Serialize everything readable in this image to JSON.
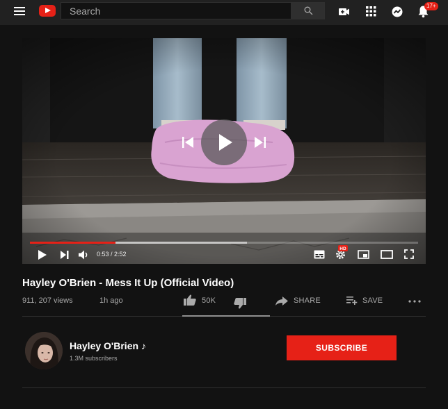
{
  "header": {
    "search_placeholder": "Search",
    "notification_count": "17+"
  },
  "player": {
    "current_time": "0:53",
    "duration": "2:52",
    "time_display": "0:53 / 2:52",
    "played_fraction": 0.22,
    "buffered_fraction": 0.56,
    "hd_badge": "HD"
  },
  "video": {
    "title": "Hayley O'Brien - Mess It Up (Official Video)",
    "views": "911, 207 views",
    "age": "1h ago",
    "likes": "50K",
    "share_label": "SHARE",
    "save_label": "SAVE",
    "like_fraction": 1.0
  },
  "channel": {
    "name": "Hayley O'Brien ♪",
    "subscribers": "1.3M subscribers",
    "subscribe_label": "SUBSCRIBE"
  },
  "colors": {
    "accent": "#e62117",
    "background": "#121212",
    "topbar": "#212121"
  }
}
